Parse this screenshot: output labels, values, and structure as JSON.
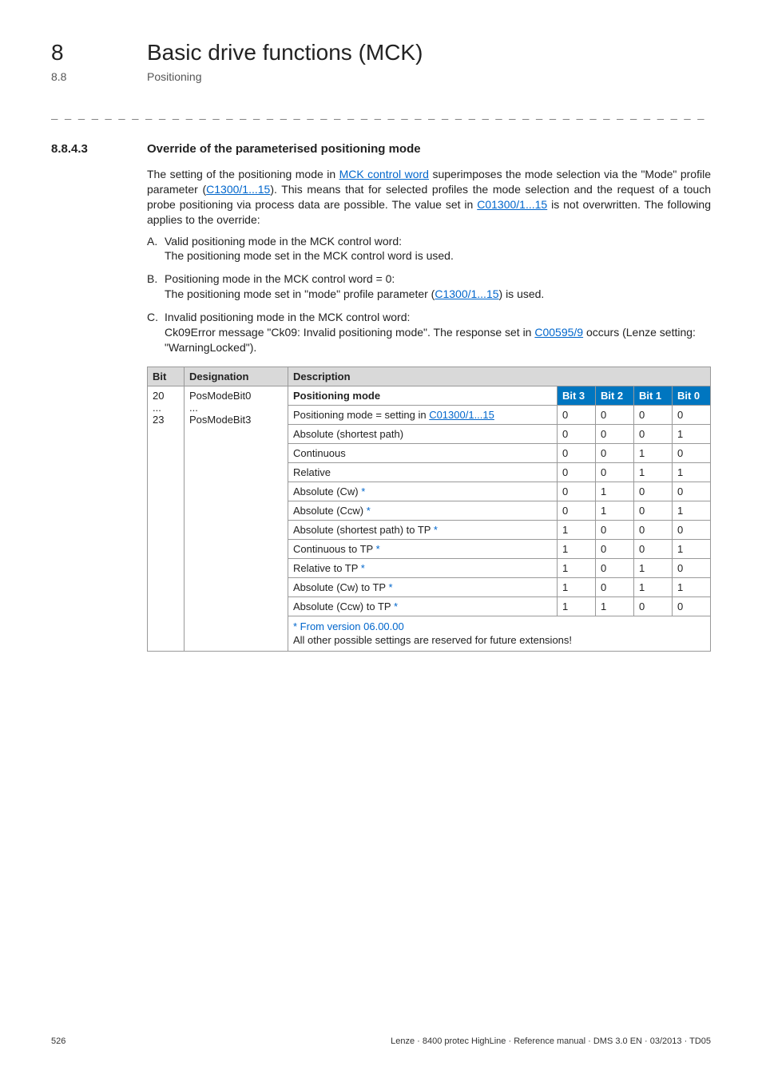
{
  "header": {
    "chapter_num": "8",
    "chapter_title": "Basic drive functions (MCK)",
    "sub_num": "8.8",
    "sub_title": "Positioning",
    "dashes": "_ _ _ _ _ _ _ _ _ _ _ _ _ _ _ _ _ _ _ _ _ _ _ _ _ _ _ _ _ _ _ _ _ _ _ _ _ _ _ _ _ _ _ _ _ _ _ _ _ _ _ _ _ _ _ _ _ _ _ _ _ _ _ _"
  },
  "section": {
    "num": "8.8.4.3",
    "title": "Override of the parameterised positioning mode",
    "para_parts": {
      "p1": "The setting of the positioning mode in ",
      "l1": "MCK control word",
      "p2": " superimposes the mode selection via the \"Mode\" profile parameter (",
      "l2": "C1300/1...15",
      "p3": "). This means that for selected profiles the mode selection and the request of a touch probe positioning via process data are possible. The value set in ",
      "l3": "C01300/1...15",
      "p4": " is not overwritten. The following applies to the override:"
    },
    "list": {
      "a_marker": "A.",
      "a_l1": "Valid positioning mode in the MCK control word:",
      "a_l2": "The positioning mode set in the MCK control word is used.",
      "b_marker": "B.",
      "b_l1": "Positioning mode in the MCK control word = 0:",
      "b_l2a": "The positioning mode set in \"mode\" profile parameter (",
      "b_l2_link": "C1300/1...15",
      "b_l2b": ") is used.",
      "c_marker": "C.",
      "c_l1": "Invalid positioning mode in the MCK control word:",
      "c_l2a": "Ck09Error message \"Ck09: Invalid positioning mode\". The response set in ",
      "c_l2_link": "C00595/9",
      "c_l2b": " occurs (Lenze setting: \"WarningLocked\").",
      "c_marker_label": "C."
    }
  },
  "table": {
    "head": {
      "bit": "Bit",
      "designation": "Designation",
      "description": "Description"
    },
    "row_label": {
      "bit_start": "20",
      "bit_dots": "...",
      "bit_end": "23",
      "desig0": "PosModeBit0",
      "desig_dots": "...",
      "desig3": "PosModeBit3"
    },
    "mode_header": {
      "label": "Positioning mode",
      "b3": "Bit 3",
      "b2": "Bit 2",
      "b1": "Bit 1",
      "b0": "Bit 0"
    },
    "rows": [
      {
        "desc_a": "Positioning mode = setting in ",
        "link": "C01300/1...15",
        "desc_b": "",
        "b3": "0",
        "b2": "0",
        "b1": "0",
        "b0": "0"
      },
      {
        "desc_a": "Absolute (shortest path)",
        "link": "",
        "desc_b": "",
        "b3": "0",
        "b2": "0",
        "b1": "0",
        "b0": "1"
      },
      {
        "desc_a": "Continuous",
        "link": "",
        "desc_b": "",
        "b3": "0",
        "b2": "0",
        "b1": "1",
        "b0": "0"
      },
      {
        "desc_a": "Relative",
        "link": "",
        "desc_b": "",
        "b3": "0",
        "b2": "0",
        "b1": "1",
        "b0": "1"
      },
      {
        "desc_a": "Absolute (Cw)",
        "link": "",
        "desc_b": " *",
        "b3": "0",
        "b2": "1",
        "b1": "0",
        "b0": "0",
        "star": true
      },
      {
        "desc_a": "Absolute (Ccw)",
        "link": "",
        "desc_b": " *",
        "b3": "0",
        "b2": "1",
        "b1": "0",
        "b0": "1",
        "star": true
      },
      {
        "desc_a": "Absolute (shortest path) to TP",
        "link": "",
        "desc_b": " *",
        "b3": "1",
        "b2": "0",
        "b1": "0",
        "b0": "0",
        "star": true
      },
      {
        "desc_a": "Continuous to TP",
        "link": "",
        "desc_b": " *",
        "b3": "1",
        "b2": "0",
        "b1": "0",
        "b0": "1",
        "star": true
      },
      {
        "desc_a": "Relative to TP",
        "link": "",
        "desc_b": " *",
        "b3": "1",
        "b2": "0",
        "b1": "1",
        "b0": "0",
        "star": true
      },
      {
        "desc_a": "Absolute (Cw) to TP",
        "link": "",
        "desc_b": " *",
        "b3": "1",
        "b2": "0",
        "b1": "1",
        "b0": "1",
        "star": true
      },
      {
        "desc_a": "Absolute (Ccw) to TP",
        "link": "",
        "desc_b": " *",
        "b3": "1",
        "b2": "1",
        "b1": "0",
        "b0": "0",
        "star": true
      }
    ],
    "footer_note_a": "* From version 06.00.00",
    "footer_note_b": "All other possible settings are reserved for future extensions!"
  },
  "footer": {
    "page": "526",
    "doc": "Lenze · 8400 protec HighLine · Reference manual · DMS 3.0 EN · 03/2013 · TD05"
  }
}
